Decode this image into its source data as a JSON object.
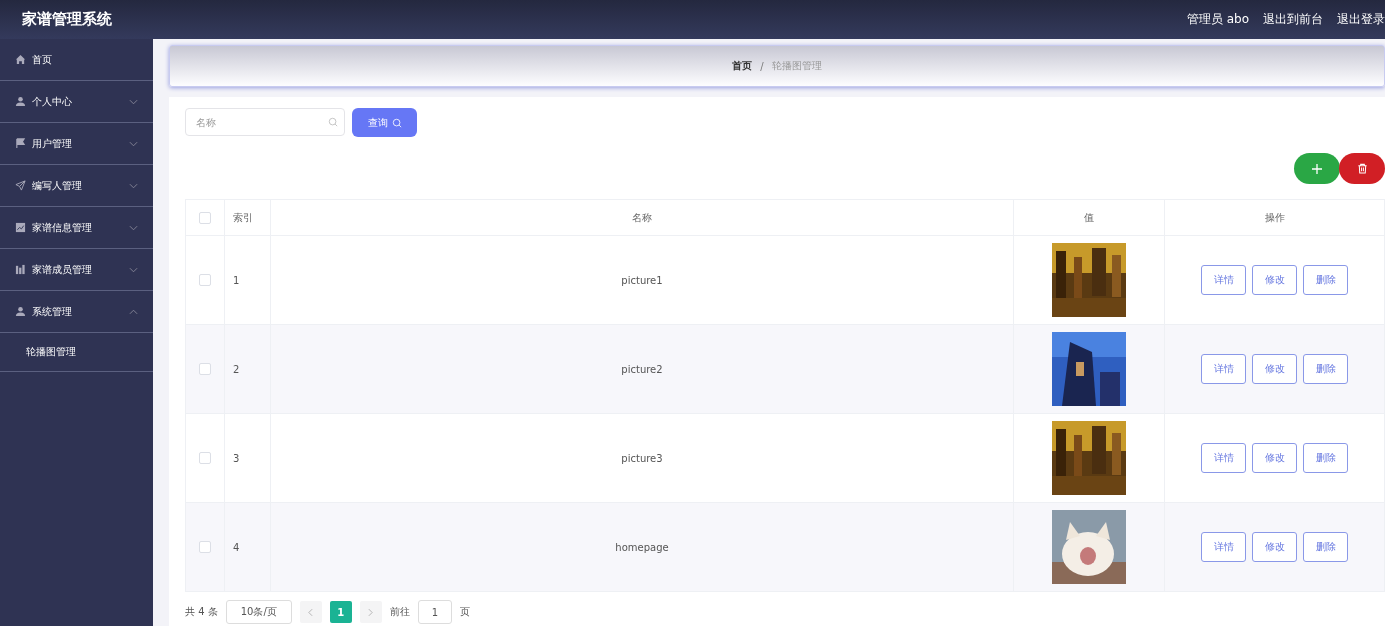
{
  "header": {
    "title": "家谱管理系统",
    "links": [
      "管理员 abo",
      "退出到前台",
      "退出登录"
    ]
  },
  "sidebar": {
    "items": [
      {
        "label": "首页"
      },
      {
        "label": "个人中心",
        "expanded": false
      },
      {
        "label": "用户管理",
        "expanded": false
      },
      {
        "label": "编写人管理",
        "expanded": false
      },
      {
        "label": "家谱信息管理",
        "expanded": false
      },
      {
        "label": "家谱成员管理",
        "expanded": false
      },
      {
        "label": "系统管理",
        "expanded": true,
        "children": [
          {
            "label": "轮播图管理"
          }
        ]
      }
    ]
  },
  "breadcrumb": {
    "items": [
      "首页",
      "轮播图管理"
    ],
    "separator": "/"
  },
  "search": {
    "placeholder": "名称",
    "button": "查询"
  },
  "table": {
    "columns": [
      "索引",
      "名称",
      "值",
      "操作"
    ],
    "all_checked": false,
    "rows": [
      {
        "index": "1",
        "name": "picture1",
        "checked": false,
        "actions": [
          "详情",
          "修改",
          "删除"
        ]
      },
      {
        "index": "2",
        "name": "picture2",
        "checked": false,
        "actions": [
          "详情",
          "修改",
          "删除"
        ]
      },
      {
        "index": "3",
        "name": "picture3",
        "checked": false,
        "actions": [
          "详情",
          "修改",
          "删除"
        ]
      },
      {
        "index": "4",
        "name": "homepage",
        "checked": false,
        "actions": [
          "详情",
          "修改",
          "删除"
        ]
      }
    ]
  },
  "pagination": {
    "total": "共 4 条",
    "page_size": "10条/页",
    "pages": [
      {
        "label": "1",
        "selected": true
      }
    ],
    "goto_label": "前往",
    "goto_value": "1",
    "goto_suffix": "页"
  }
}
